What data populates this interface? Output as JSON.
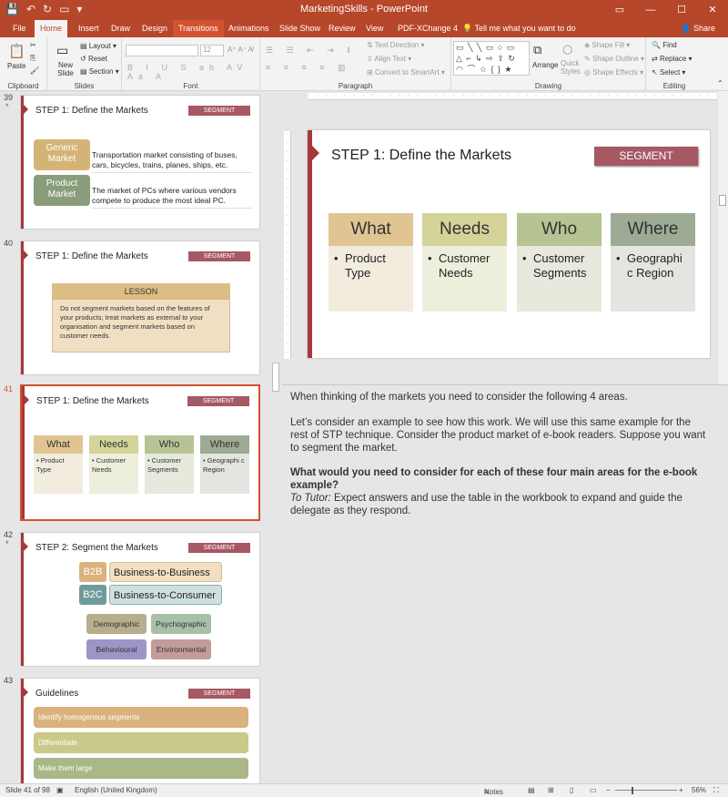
{
  "window": {
    "title": "MarketingSkills  -  PowerPoint",
    "controls": [
      "▭",
      "—",
      "☐",
      "✕"
    ]
  },
  "tabs": [
    "File",
    "Home",
    "Insert",
    "Draw",
    "Design",
    "Transitions",
    "Animations",
    "Slide Show",
    "Review",
    "View",
    "PDF-XChange 4",
    "Tell me what you want to do"
  ],
  "share": "Share",
  "ribbon": {
    "clipboard": {
      "label": "Clipboard",
      "paste": "Paste"
    },
    "slides": {
      "label": "Slides",
      "new_slide": "New Slide",
      "layout": "Layout",
      "reset": "Reset",
      "section": "Section"
    },
    "font": {
      "label": "Font",
      "size": "12"
    },
    "paragraph": {
      "label": "Paragraph",
      "text_direction": "Text Direction",
      "align_text": "Align Text",
      "smartart": "Convert to SmartArt"
    },
    "drawing": {
      "label": "Drawing",
      "arrange": "Arrange",
      "quick_styles": "Quick Styles",
      "shape_fill": "Shape Fill",
      "shape_outline": "Shape Outline",
      "shape_effects": "Shape Effects"
    },
    "editing": {
      "label": "Editing",
      "find": "Find",
      "replace": "Replace",
      "select": "Select"
    }
  },
  "thumbnails": {
    "s39": {
      "num": "39",
      "star": "*",
      "title": "STEP 1: Define the Markets",
      "badge": "SEGMENT",
      "rows": [
        {
          "pill": "Generic Market",
          "text": "Transportation market consisting of buses, cars, bicycles, trains, planes, ships, etc."
        },
        {
          "pill": "Product Market",
          "text": "The market of PCs where various vendors compete to produce the most ideal PC."
        }
      ]
    },
    "s40": {
      "num": "40",
      "title": "STEP 1: Define the Markets",
      "badge": "SEGMENT",
      "lesson_head": "LESSON",
      "lesson_body": "Do not segment markets based on the features of your products; treat markets as external to your organisation and segment markets based on customer needs."
    },
    "s41": {
      "num": "41",
      "title": "STEP 1: Define the Markets",
      "badge": "SEGMENT",
      "cols": [
        {
          "head": "What",
          "body": "• Product Type"
        },
        {
          "head": "Needs",
          "body": "• Customer Needs"
        },
        {
          "head": "Who",
          "body": "• Customer Segments"
        },
        {
          "head": "Where",
          "body": "• Geographi c Region"
        }
      ]
    },
    "s42": {
      "num": "42",
      "star": "*",
      "title": "STEP 2: Segment the Markets",
      "badge": "SEGMENT",
      "b2b_tag": "B2B",
      "b2b": "Business-to-Business",
      "b2c_tag": "B2C",
      "b2c": "Business-to-Consumer",
      "segs": [
        "Demographic",
        "Psychographic",
        "Behavioural",
        "Environmental"
      ]
    },
    "s43": {
      "num": "43",
      "title": "Guidelines",
      "badge": "SEGMENT",
      "bars": [
        "Identify homogenous segments",
        "Differentiate",
        "Make them large"
      ]
    }
  },
  "slide": {
    "title": "STEP 1: Define the Markets",
    "badge": "SEGMENT",
    "cols": [
      {
        "head": "What",
        "body": "Product Type"
      },
      {
        "head": "Needs",
        "body": "Customer Needs"
      },
      {
        "head": "Who",
        "body": "Customer Segments"
      },
      {
        "head": "Where",
        "body": "Geographi c Region"
      }
    ]
  },
  "notes": {
    "p1": "When thinking of the markets you need to consider the following 4 areas.",
    "p2": "Let’s consider an example to see how this work. We will use this same example for the rest of STP technique. Consider the product market of e-book readers. Suppose you want to segment the market.",
    "p3": "What would you need to consider for each of these four main areas for the e-book example?",
    "p4_label": "To Tutor:",
    "p4": " Expect answers and use the table in the workbook to expand and guide the delegate as they respond."
  },
  "status": {
    "slide": "Slide 41 of 98",
    "language": "English (United Kingdom)",
    "notes": "Notes",
    "zoom": "56%"
  },
  "colors": {
    "brand": "#b7472a",
    "accent_bar": "#a6373a",
    "badge": "#a65863",
    "what_head": "#e0c593",
    "what_body": "#f2ecdf",
    "needs_head": "#d4d49a",
    "needs_body": "#eeeedd",
    "who_head": "#b6c393",
    "who_body": "#e6e9dc",
    "where_head": "#9daa94",
    "where_body": "#e2e5e0"
  }
}
